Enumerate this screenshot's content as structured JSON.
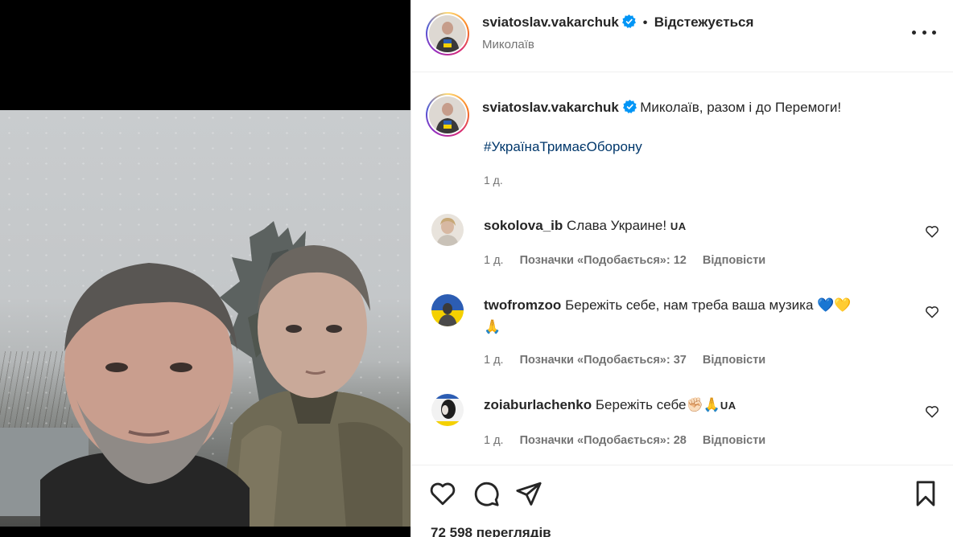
{
  "post": {
    "username": "sviatoslav.vakarchuk",
    "follow_status": "Відстежується",
    "location": "Миколаїв",
    "caption": "Миколаїв, разом і до Перемоги!",
    "hashtag": "#УкраїнаТримаєОборону",
    "time": "1 д.",
    "views": "72 598 переглядів"
  },
  "comments": [
    {
      "username": "sokolova_ib",
      "text": "Слава Украине!",
      "flag": "UA",
      "time": "1 д.",
      "likes": "Позначки «Подобається»: 12",
      "reply": "Відповісти"
    },
    {
      "username": "twofromzoo",
      "text": "Бережіть себе, нам треба ваша музика",
      "emoji": "💙💛",
      "emoji2": "🙏",
      "time": "1 д.",
      "likes": "Позначки «Подобається»: 37",
      "reply": "Відповісти"
    },
    {
      "username": "zoiaburlachenko",
      "text": "Бережіть себе",
      "emoji": "✊🏻🙏",
      "flag": "UA",
      "time": "1 д.",
      "likes": "Позначки «Подобається»: 28",
      "reply": "Відповісти"
    }
  ],
  "icons": {
    "verified": "verified-badge-icon",
    "more": "more-options-icon",
    "like": "heart-icon",
    "comment": "comment-icon",
    "share": "share-icon",
    "save": "bookmark-icon"
  },
  "colors": {
    "verified": "#0095f6",
    "hashtag": "#00376b",
    "muted": "#737373",
    "text": "#262626"
  }
}
